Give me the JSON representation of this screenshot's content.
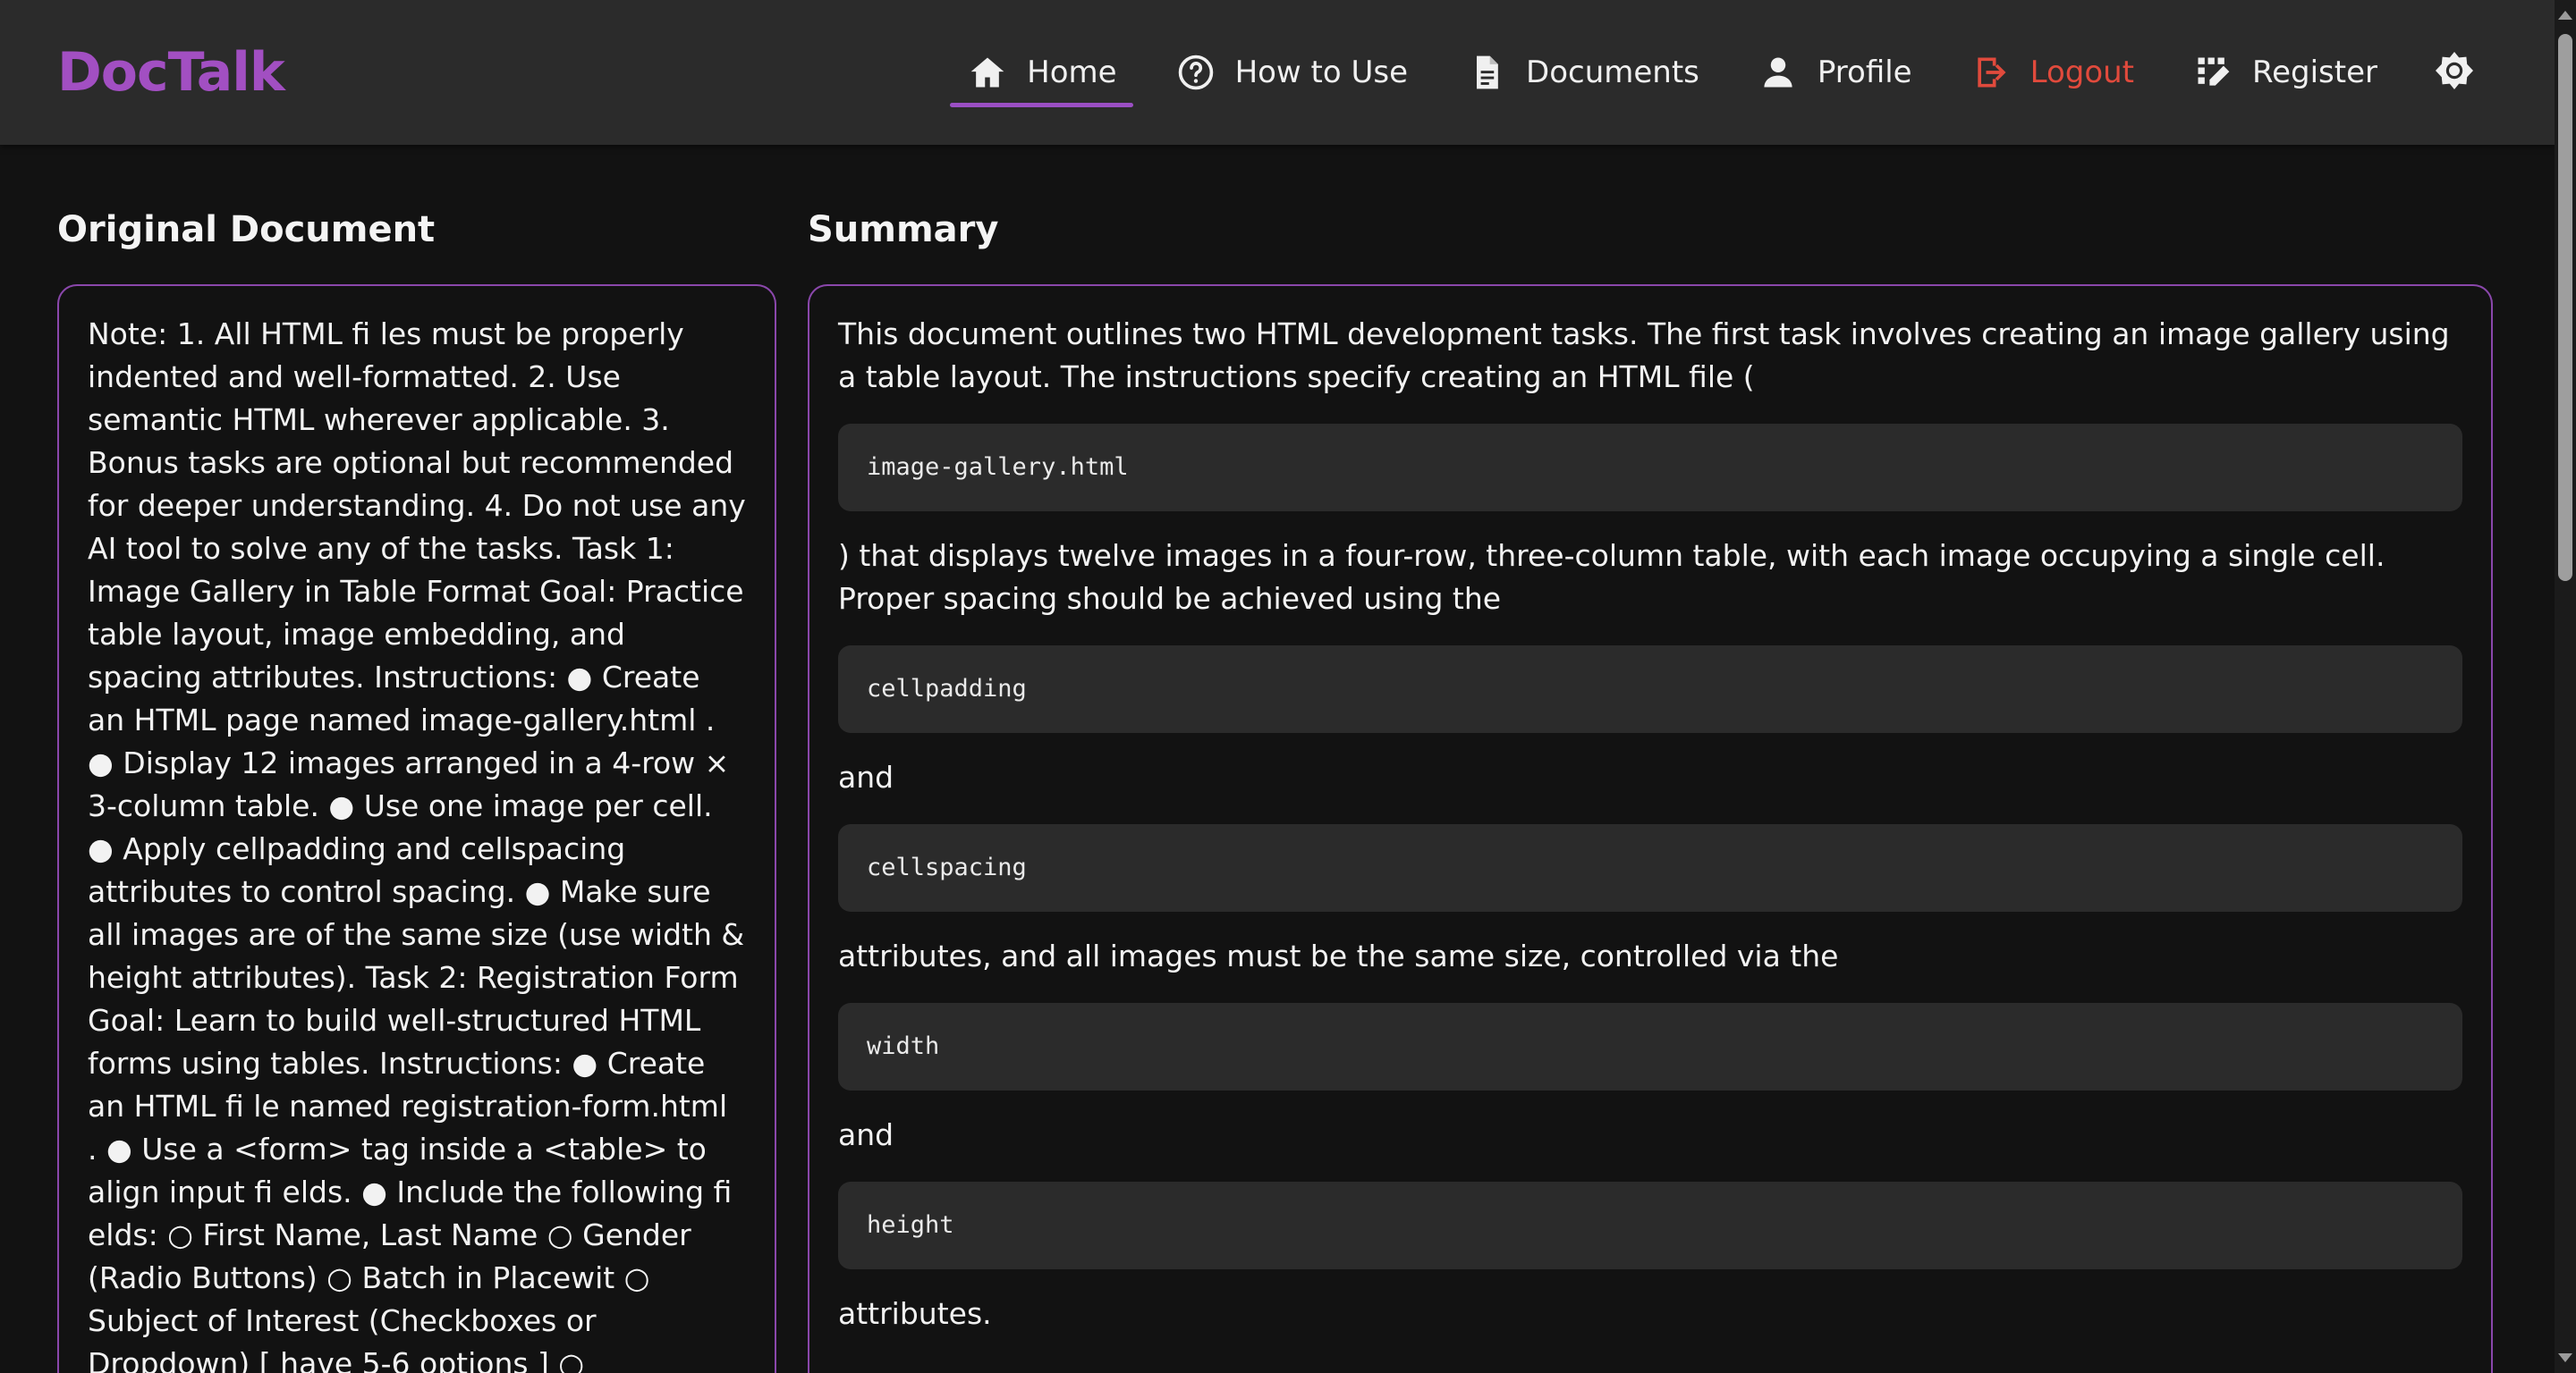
{
  "brand": "DocTalk",
  "nav": {
    "home": "Home",
    "how_to_use": "How to Use",
    "documents": "Documents",
    "profile": "Profile",
    "logout": "Logout",
    "register": "Register"
  },
  "colors": {
    "brand": "#a24fc2",
    "accent": "#9b4fc4",
    "logout": "#e14a3c",
    "background": "#121212",
    "navbar": "#2b2b2b"
  },
  "original": {
    "title": "Original Document",
    "text": "Note: 1. All HTML fi les must be properly indented and well-formatted. 2. Use semantic HTML wherever applicable. 3. Bonus tasks are optional but recommended for deeper understanding. 4. Do not use any AI tool to solve any of the tasks. Task 1: Image Gallery in Table Format Goal: Practice table layout, image embedding, and spacing attributes. Instructions: ● Create an HTML page named image-gallery.html . ● Display 12 images arranged in a 4-row × 3-column table. ● Use one image per cell. ● Apply cellpadding and cellspacing attributes to control spacing. ● Make sure all images are of the same size (use width & height attributes). Task 2: Registration Form Goal: Learn to build well-structured HTML forms using tables. Instructions: ● Create an HTML fi le named registration-form.html . ● Use a <form> tag inside a <table> to align input fi elds. ● Include the following fi elds: ○ First Name, Last Name ○ Gender (Radio Buttons) ○ Batch in Placewit ○ Subject of Interest (Checkboxes or Dropdown) [ have 5-6 options ] ○ Languages Known (Checkboxes) ["
  },
  "summary": {
    "title": "Summary",
    "p1": "This document outlines two HTML development tasks. The first task involves creating an image gallery using a table layout. The instructions specify creating an HTML file (",
    "code1": "image-gallery.html",
    "p2": ") that displays twelve images in a four-row, three-column table, with each image occupying a single cell. Proper spacing should be achieved using the",
    "code2": "cellpadding",
    "p3": "and",
    "code3": "cellspacing",
    "p4": "attributes, and all images must be the same size, controlled via the",
    "code4": "width",
    "p5": "and",
    "code5": "height",
    "p6": "attributes."
  }
}
